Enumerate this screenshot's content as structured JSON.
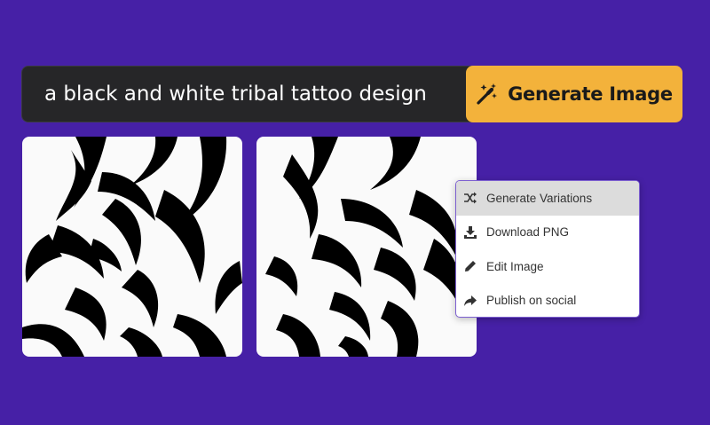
{
  "prompt": {
    "value": "a black and white tribal tattoo design",
    "generate_label": "Generate Image",
    "generate_icon": "magic-wand-icon"
  },
  "images": [
    {
      "name": "tribal-tattoo-image-1"
    },
    {
      "name": "tribal-tattoo-image-2"
    }
  ],
  "context_menu": {
    "items": [
      {
        "label": "Generate Variations",
        "icon": "shuffle-icon",
        "active": true
      },
      {
        "label": "Download PNG",
        "icon": "download-icon"
      },
      {
        "label": "Edit Image",
        "icon": "pencil-icon"
      },
      {
        "label": "Publish on social",
        "icon": "share-icon"
      }
    ]
  },
  "colors": {
    "background": "#4620a6",
    "prompt_bar": "#262628",
    "accent_button": "#f3b23b",
    "menu_highlight": "#dcdcdc"
  }
}
